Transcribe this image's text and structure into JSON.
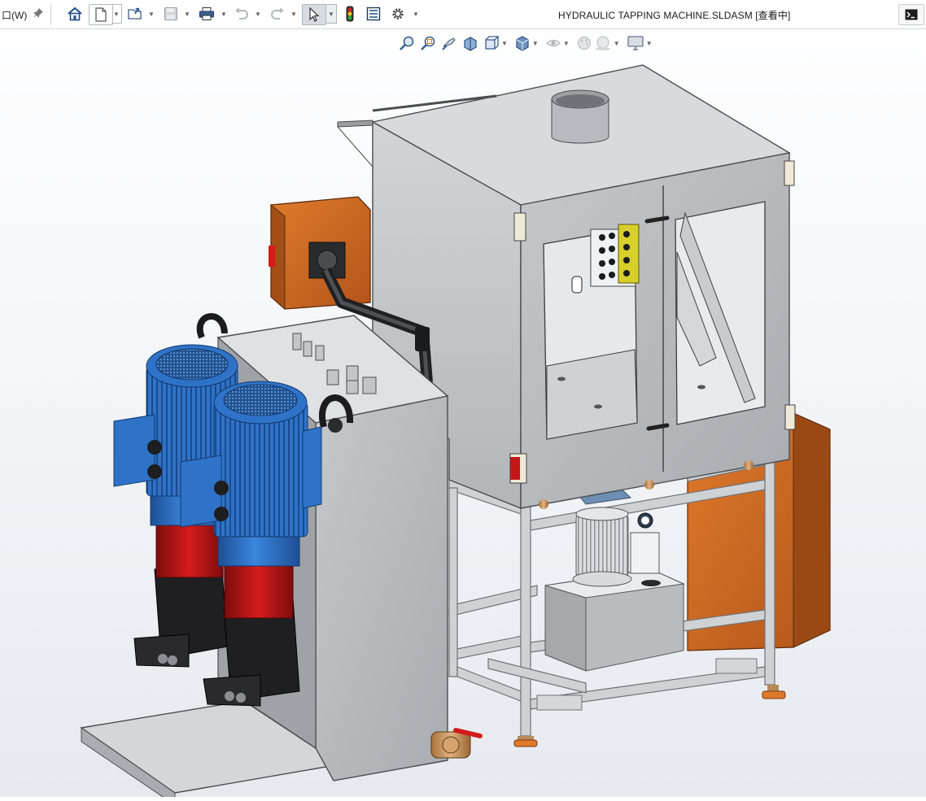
{
  "window": {
    "menu_stub": "口(W)",
    "document_title": "HYDRAULIC TAPPING MACHINE.SLDASM [查看中]"
  },
  "toolbar": {
    "items": [
      "home-icon",
      "new-document-icon",
      "open-document-icon",
      "save-icon",
      "print-icon",
      "undo-icon",
      "redo-icon",
      "select-arrow-icon",
      "rebuild-traffic-light-icon",
      "file-properties-icon",
      "options-gear-icon"
    ]
  },
  "view_toolbar": {
    "items": [
      "zoom-to-fit-icon",
      "zoom-to-area-icon",
      "previous-view-icon",
      "section-view-icon",
      "view-orientation-icon",
      "display-style-icon",
      "hide-show-items-icon",
      "edit-appearance-icon",
      "apply-scene-icon",
      "view-settings-icon"
    ]
  },
  "colors": {
    "motor_blue": "#2f73c8",
    "pump_red": "#c41616",
    "pump_black": "#1f1f22",
    "box_orange": "#c8651c",
    "sheet_metal": "#b9bbbe",
    "frame_aluminium": "#c9cccf",
    "background_top": "#ffffff",
    "background_bottom": "#e6eaef"
  },
  "model": {
    "name": "Hydraulic tapping machine assembly"
  }
}
